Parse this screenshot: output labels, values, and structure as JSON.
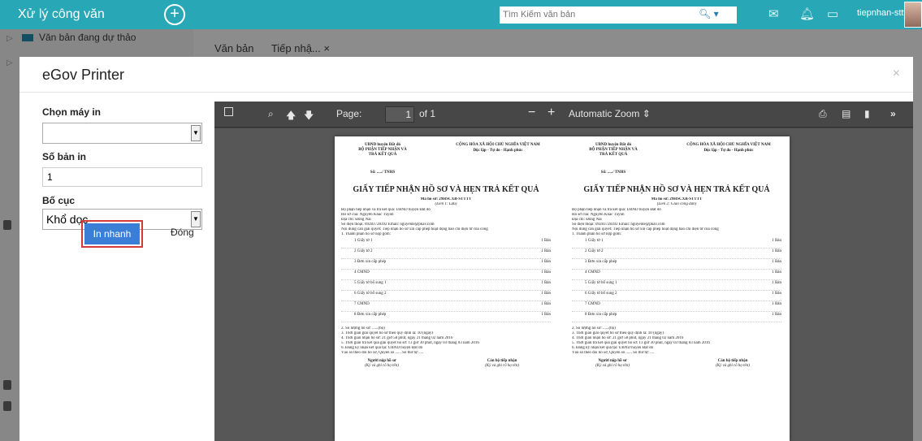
{
  "app": {
    "title": "Xử lý công văn"
  },
  "search": {
    "placeholder": "Tìm Kiếm văn bản"
  },
  "user": {
    "name": "tiepnhan-stttt"
  },
  "background": {
    "sidebar_item": "Văn bản đang dự thảo",
    "tabs": [
      "Văn bản",
      "Tiếp nhậ... ×"
    ]
  },
  "modal": {
    "title": "eGov Printer",
    "printer_label": "Chọn máy in",
    "printer_value": "",
    "copies_label": "Số bản in",
    "copies_value": "1",
    "layout_label": "Bố cục",
    "layout_value": "Khổ dọc",
    "print_button": "In nhanh",
    "close_button": "Đóng"
  },
  "viewer": {
    "page_label": "Page:",
    "page_value": "1",
    "page_of": "of 1",
    "zoom": "Automatic Zoom"
  },
  "document": {
    "left_header": [
      "UBND huyện Đất đỏ",
      "BỘ PHẬN TIẾP NHẬN VÀ",
      "TRẢ KẾT QUẢ",
      "Số: ...../ TNHS"
    ],
    "right_header": [
      "CỘNG HÒA XÃ HỘI CHỦ NGHĨA VIỆT NAM",
      "Độc lập - Tự do - Hạnh phúc"
    ],
    "title": "GIẤY TIẾP NHẬN HỒ SƠ VÀ HẸN TRẢ KẾT QUẢ",
    "code": "Mã hồ sơ: 29HSCXB-STTTT",
    "copy_left": "(Liên 1: Lưu)",
    "copy_right": "(Liên 2: Giao công dân)",
    "info": [
      "Bộ phận tiếp nhận và trả kết quả: UBND huyện Đất đỏ",
      "Hồ sơ của: Nguyễn Khắc Tuynh",
      "Địa chỉ: Đồng Nai",
      "Số điện thoại: 09283728392          Email: nguyente@pkav.com",
      "Nội dung cần giải quyết: Tiếp nhận hồ sơ xin cấp phép hoạt động báo chí điện tử của công",
      "1. Thành phần hồ sơ nộp gồm:"
    ],
    "items": [
      {
        "no": "1",
        "name": "Giấy tờ 1",
        "qty": "1 Bản"
      },
      {
        "no": "2",
        "name": "Giấy tờ 2",
        "qty": "1 Bản"
      },
      {
        "no": "3",
        "name": "Đơn xin cấp phép",
        "qty": "1 Bản"
      },
      {
        "no": "4",
        "name": "CMND",
        "qty": "1 Bản"
      },
      {
        "no": "5",
        "name": "Giấy tờ bổ sung 1",
        "qty": "1 Bản"
      },
      {
        "no": "6",
        "name": "Giấy tờ bổ sung 2",
        "qty": "1 Bản"
      },
      {
        "no": "7",
        "name": "CMND",
        "qty": "1 Bản"
      },
      {
        "no": "8",
        "name": "Đơn xin cấp phép",
        "qty": "1 Bản"
      }
    ],
    "footer": [
      "2. Số lượng hồ sơ: ......(bộ)",
      "3. Thời gian giải quyết hồ sơ theo quy định là: 10 (ngày)",
      "4. Thời gian nhận hồ sơ: 21 giờ 58 phút, ngày 21 tháng 02 năm 2016",
      "5. Thời gian trả kết quả giải quyết hồ sơ: 13 giờ 30 phút, ngày 03 tháng 03 năm 2016",
      "6. Đăng ký nhận kết quả tại: UBND huyện Đất đỏ",
      "Vào sổ theo dõi hồ sơ, Quyển số ...... Số thứ tự: ...."
    ],
    "sign_left": "Người nộp hồ sơ",
    "sign_left_note": "(Ký và ghi rõ họ tên)",
    "sign_right": "Cán bộ tiếp nhận",
    "sign_right_note": "(Ký và ghi rõ họ tên)"
  }
}
